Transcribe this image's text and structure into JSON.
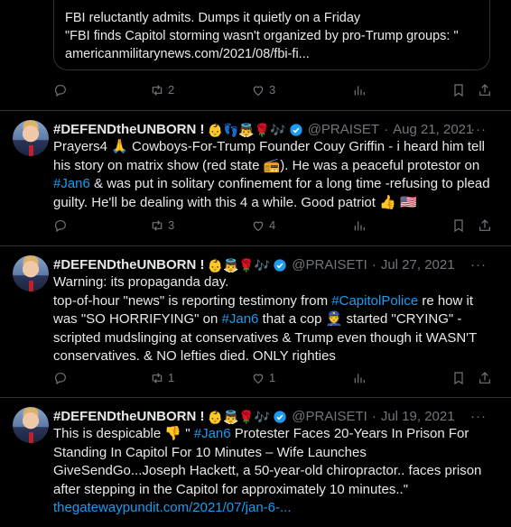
{
  "quote": {
    "line1": "FBI reluctantly admits. Dumps it quietly on a Friday",
    "line2": "  \"FBI finds Capitol storming wasn't organized by pro-Trump groups: \"",
    "line3": "americanmilitarynews.com/2021/08/fbi-fi..."
  },
  "top_actions": {
    "retweets": "2",
    "likes": "3"
  },
  "tweets": [
    {
      "name": "#DEFENDtheUNBORN !",
      "emoji": "👶👣👼🌹🎶",
      "handle": "@PRAISET",
      "date": "Aug 21, 2021",
      "text_a": "Prayers4 🙏 Cowboys-For-Trump Founder Couy Griffin - i heard him tell his story on matrix show (red state 📻). He was a peaceful protestor on ",
      "tag1": "#Jan6",
      "text_b": " & was put in solitary confinement for a long time -refusing to plead guilty. He'll be dealing with this 4 a while. Good patriot 👍 🇺🇸",
      "retweets": "3",
      "likes": "4"
    },
    {
      "name": "#DEFENDtheUNBORN !",
      "emoji": "👶👼🌹🎶",
      "handle": "@PRAISETI",
      "date": "Jul 27, 2021",
      "line1": "Warning: its propaganda day.",
      "text_a": "top-of-hour \"news\" is reporting testimony from ",
      "tag1": "#CapitolPolice",
      "text_b": " re how it was \"SO HORRIFYING\" on ",
      "tag2": "#Jan6",
      "text_c": " that a cop 👮 started \"CRYING\" -scripted mudslinging at conservatives & Trump even though it WASN'T conservatives. & NO lefties died. ONLY righties",
      "retweets": "1",
      "likes": "1"
    },
    {
      "name": "#DEFENDtheUNBORN !",
      "emoji": "👶👼🌹🎶",
      "handle": "@PRAISETI",
      "date": "Jul 19, 2021",
      "text_a": "This is despicable 👎 \" ",
      "tag1": "#Jan6",
      "text_b": " Protester Faces 20-Years In Prison For Standing In Capitol For 10 Minutes – Wife Launches GiveSendGo...Joseph Hackett, a 50-year-old chiropractor.. faces prison after stepping in the Capitol  for approximately 10 minutes..\"",
      "link": "thegatewaypundit.com/2021/07/jan-6-..."
    }
  ],
  "colors": {
    "accent": "#1d9bf0",
    "muted": "#71767b",
    "text": "#e7e9ea",
    "bg": "#000000"
  }
}
